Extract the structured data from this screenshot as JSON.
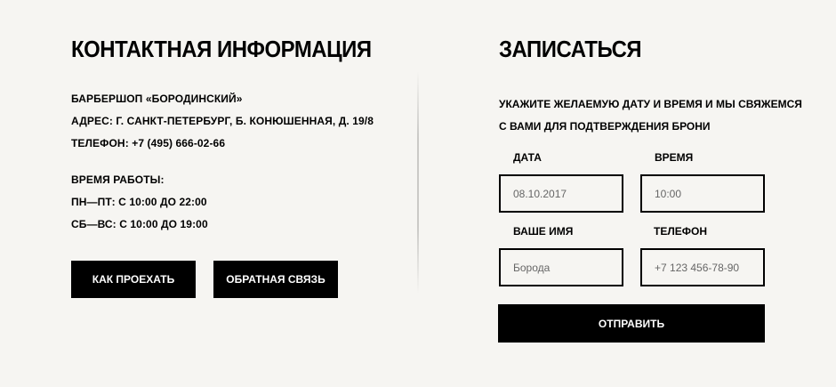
{
  "contacts": {
    "title": "КОНТАКТНАЯ ИНФОРМАЦИЯ",
    "name": "БАРБЕРШОП «БОРОДИНСКИЙ»",
    "address": "АДРЕС: Г. САНКТ-ПЕТЕРБУРГ, Б. КОНЮШЕННАЯ, Д. 19/8",
    "phone": "ТЕЛЕФОН: +7 (495) 666-02-66",
    "hours_title": "ВРЕМЯ РАБОТЫ:",
    "hours_weekdays": "ПН—ПТ: С 10:00 ДО 22:00",
    "hours_weekend": "СБ—ВС: С 10:00 ДО 19:00",
    "directions_button": "КАК ПРОЕХАТЬ",
    "feedback_button": "ОБРАТНАЯ СВЯЗЬ"
  },
  "booking": {
    "title": "ЗАПИСАТЬСЯ",
    "description_line1": "УКАЖИТЕ ЖЕЛАЕМУЮ ДАТУ И ВРЕМЯ И МЫ СВЯЖЕМСЯ",
    "description_line2": "С ВАМИ ДЛЯ ПОДТВЕРЖДЕНИЯ БРОНИ",
    "date_label": "ДАТА",
    "date_placeholder": "08.10.2017",
    "time_label": "ВРЕМЯ",
    "time_placeholder": "10:00",
    "name_label": "ВАШЕ ИМЯ",
    "name_placeholder": "Борода",
    "phone_label": "ТЕЛЕФОН",
    "phone_placeholder": "+7 123 456-78-90",
    "submit_button": "ОТПРАВИТЬ"
  },
  "colors": {
    "background": "#f6f5f2",
    "text": "#000000",
    "button_bg": "#000000",
    "button_text": "#ffffff"
  }
}
